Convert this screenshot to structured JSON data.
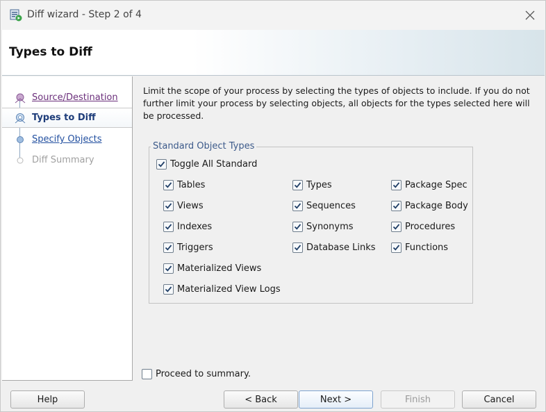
{
  "window": {
    "title": "Diff wizard - Step 2 of 4",
    "close_icon": "close-icon"
  },
  "banner": {
    "title": "Types to Diff"
  },
  "nav": {
    "items": [
      {
        "label": "Source/Destination",
        "state": "visited"
      },
      {
        "label": "Types to Diff",
        "state": "current"
      },
      {
        "label": "Specify Objects",
        "state": "link"
      },
      {
        "label": "Diff Summary",
        "state": "disabled"
      }
    ]
  },
  "main": {
    "description": "Limit the scope of your process by selecting the types of objects to include.  If you do not further limit your process by selecting objects, all objects for the types selected here will be processed.",
    "group_title": "Standard Object Types",
    "toggle_all": {
      "label": "Toggle All Standard",
      "checked": true
    },
    "columns": [
      [
        {
          "label": "Tables",
          "checked": true
        },
        {
          "label": "Views",
          "checked": true
        },
        {
          "label": "Indexes",
          "checked": true
        },
        {
          "label": "Triggers",
          "checked": true
        },
        {
          "label": "Materialized Views",
          "checked": true
        },
        {
          "label": "Materialized View Logs",
          "checked": true
        }
      ],
      [
        {
          "label": "Types",
          "checked": true
        },
        {
          "label": "Sequences",
          "checked": true
        },
        {
          "label": "Synonyms",
          "checked": true
        },
        {
          "label": "Database Links",
          "checked": true
        }
      ],
      [
        {
          "label": "Package Spec",
          "checked": true
        },
        {
          "label": "Package Body",
          "checked": true
        },
        {
          "label": "Procedures",
          "checked": true
        },
        {
          "label": "Functions",
          "checked": true
        }
      ]
    ]
  },
  "footer": {
    "proceed": {
      "label": "Proceed to summary.",
      "checked": false
    },
    "buttons": {
      "help": "Help",
      "back": "< Back",
      "next": "Next >",
      "finish": "Finish",
      "cancel": "Cancel"
    }
  }
}
